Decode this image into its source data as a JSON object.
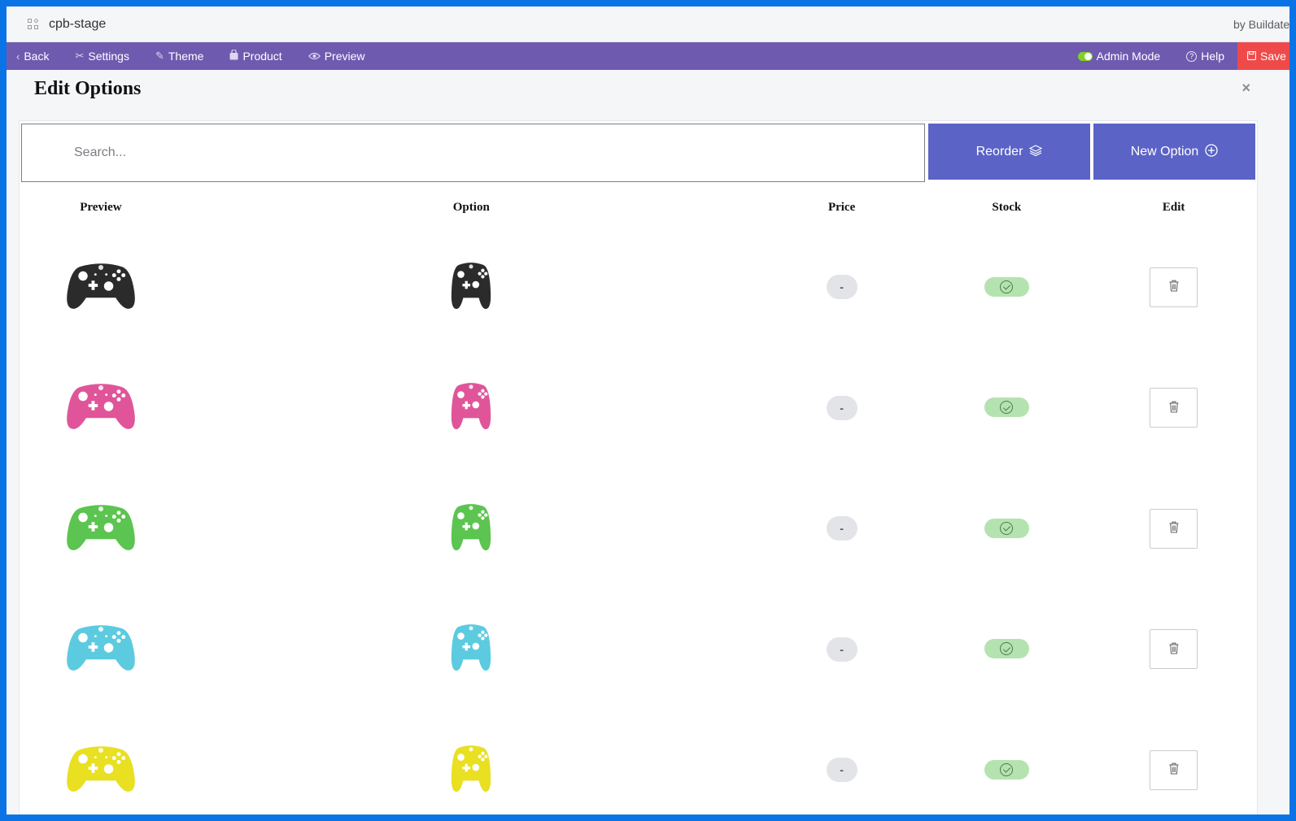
{
  "app": {
    "title": "cpb-stage",
    "by": "by Buildatea"
  },
  "toolbar": {
    "back": "Back",
    "settings": "Settings",
    "theme": "Theme",
    "product": "Product",
    "preview": "Preview",
    "admin_mode": "Admin Mode",
    "help": "Help",
    "save": "Save"
  },
  "editor": {
    "title": "Edit Options",
    "close": "×",
    "search_placeholder": "Search...",
    "reorder": "Reorder",
    "new_option": "New Option"
  },
  "table": {
    "columns": [
      "Preview",
      "Option",
      "Price",
      "Stock",
      "Edit"
    ],
    "rows": [
      {
        "color": "#2b2b2b",
        "price": "-"
      },
      {
        "color": "#e0559a",
        "price": "-"
      },
      {
        "color": "#5cc450",
        "price": "-"
      },
      {
        "color": "#5ccbe0",
        "price": "-"
      },
      {
        "color": "#e8e020",
        "price": "-"
      }
    ]
  },
  "colors": {
    "toolbar": "#6e5bb0",
    "accent_button": "#5b63c6",
    "save": "#ef4a4a",
    "stock_ok": "#b5e3b0",
    "toggle_on": "#7ed321"
  }
}
